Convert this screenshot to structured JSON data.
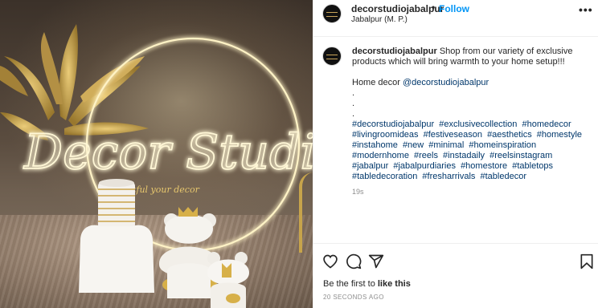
{
  "post": {
    "username": "decorstudiojabalpur",
    "follow_label": "Follow",
    "location": "Jabalpur (M. P.)",
    "more_icon": "•••",
    "caption": {
      "username": "decorstudiojabalpur",
      "text": "Shop from our variety of exclusive products which will bring warmth to your home setup!!!",
      "home_decor_text": "Home decor",
      "mention": "@decorstudiojabalpur",
      "dots": [
        ".",
        ".",
        "."
      ],
      "hashtags": [
        "#decorstudiojabalpur",
        "#exclusivecollection",
        "#homedecor",
        "#livingroomideas",
        "#festiveseason",
        "#aesthetics",
        "#homestyle",
        "#instahome",
        "#new",
        "#minimal",
        "#homeinspiration",
        "#modernhome",
        "#reels",
        "#instadaily",
        "#reelsinstagram",
        "#jabalpur",
        "#jabalpurdiaries",
        "#homestore",
        "#tabletops",
        "#tabledecoration",
        "#fresharrivals",
        "#tabledecor"
      ]
    },
    "caption_age": "19s",
    "likes_prefix": "Be the first to",
    "likes_link": "like this",
    "posted_ago": "20 SECONDS AGO"
  },
  "image": {
    "neon_text": "Decor Studio",
    "neon_subtext": "... tatful your decor",
    "colors": {
      "neon": "#fff3c6",
      "gold": "#c9a24a"
    }
  },
  "icons": [
    "heart-icon",
    "comment-icon",
    "share-icon",
    "bookmark-icon",
    "more-options-icon"
  ],
  "colors": {
    "accent": "#0095f6",
    "link": "#00376b",
    "muted": "#8e8e8e"
  }
}
